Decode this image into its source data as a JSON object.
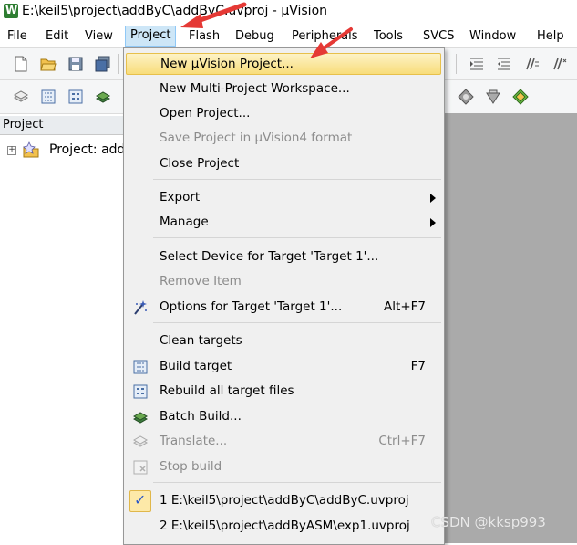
{
  "window": {
    "title": "E:\\keil5\\project\\addByC\\addByC.uvproj - µVision"
  },
  "menubar": {
    "items": [
      {
        "label": "File"
      },
      {
        "label": "Edit"
      },
      {
        "label": "View"
      },
      {
        "label": "Project"
      },
      {
        "label": "Flash"
      },
      {
        "label": "Debug"
      },
      {
        "label": "Peripherals"
      },
      {
        "label": "Tools"
      },
      {
        "label": "SVCS"
      },
      {
        "label": "Window"
      },
      {
        "label": "Help"
      }
    ]
  },
  "project_panel": {
    "title": "Project",
    "root_label": "Project: addl"
  },
  "project_menu": {
    "items": [
      {
        "label": "New µVision Project...",
        "shortcut": ""
      },
      {
        "label": "New Multi-Project Workspace...",
        "shortcut": ""
      },
      {
        "label": "Open Project...",
        "shortcut": ""
      },
      {
        "label": "Save Project in µVision4 format",
        "shortcut": ""
      },
      {
        "label": "Close Project",
        "shortcut": ""
      },
      {
        "label": "Export",
        "shortcut": ""
      },
      {
        "label": "Manage",
        "shortcut": ""
      },
      {
        "label": "Select Device for Target 'Target 1'...",
        "shortcut": ""
      },
      {
        "label": "Remove Item",
        "shortcut": ""
      },
      {
        "label": "Options for Target 'Target 1'...",
        "shortcut": "Alt+F7"
      },
      {
        "label": "Clean targets",
        "shortcut": ""
      },
      {
        "label": "Build target",
        "shortcut": "F7"
      },
      {
        "label": "Rebuild all target files",
        "shortcut": ""
      },
      {
        "label": "Batch Build...",
        "shortcut": ""
      },
      {
        "label": "Translate...",
        "shortcut": "Ctrl+F7"
      },
      {
        "label": "Stop build",
        "shortcut": ""
      },
      {
        "label": "1 E:\\keil5\\project\\addByC\\addByC.uvproj",
        "shortcut": ""
      },
      {
        "label": "2 E:\\keil5\\project\\addByASM\\exp1.uvproj",
        "shortcut": ""
      }
    ]
  },
  "watermark": "CSDN @kksp993",
  "colors": {
    "menu_highlight": "#f8dd7a",
    "menubar_active": "#cde6f7",
    "editor_background": "#aaaaaa",
    "annotation_arrow": "#e53935"
  }
}
